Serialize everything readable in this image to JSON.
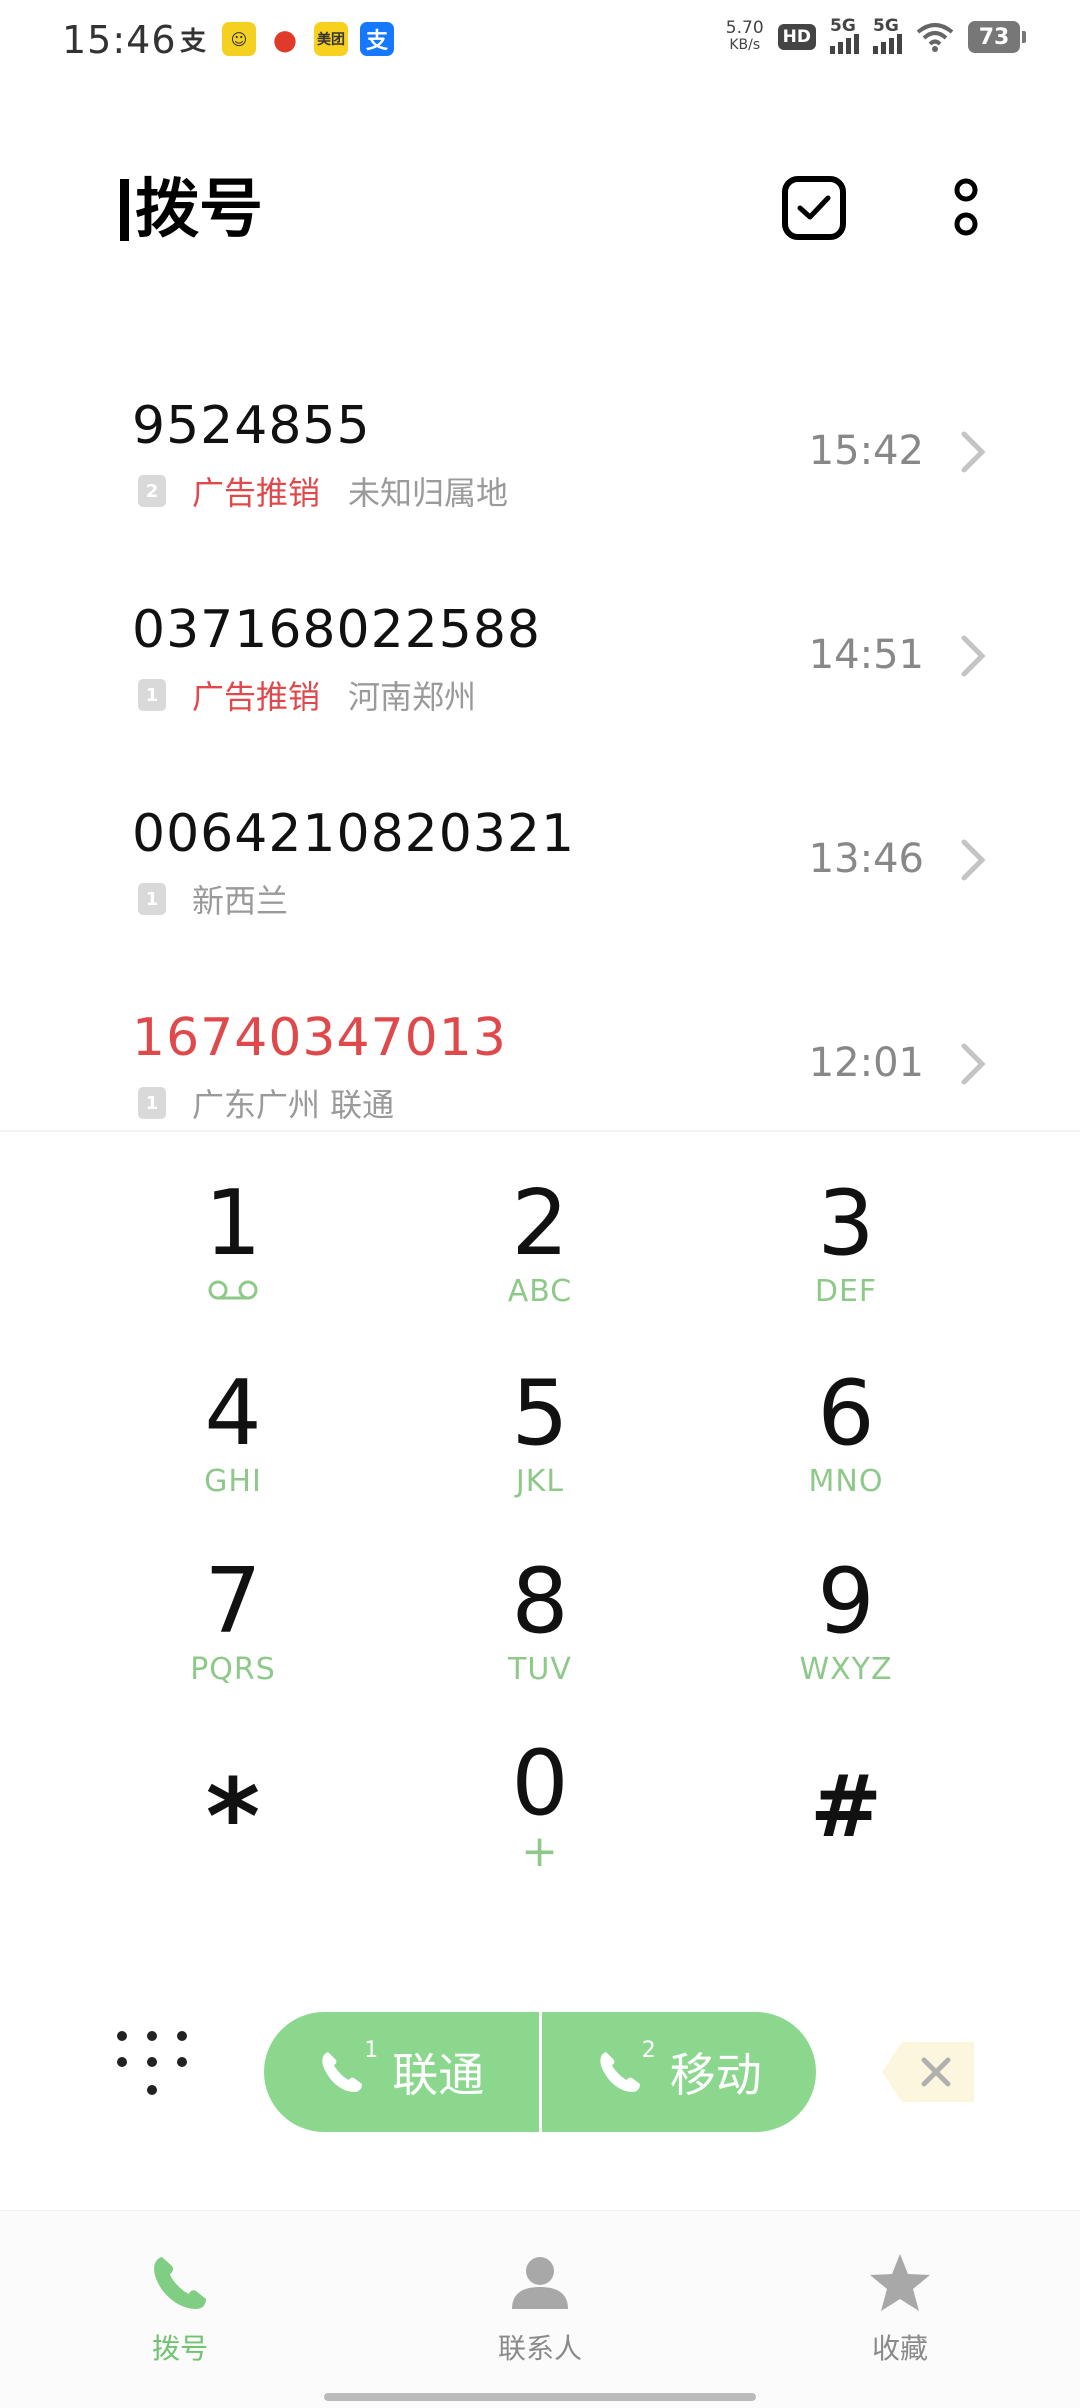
{
  "status": {
    "time": "15:46",
    "net_speed_value": "5.70",
    "net_speed_unit": "KB/s",
    "hd_label": "HD",
    "sim1_net": "5G",
    "sim2_net": "5G",
    "battery": "73",
    "notification_apps": [
      {
        "name": "alipay-icon",
        "glyph": "支"
      },
      {
        "name": "app-icon-yellow",
        "glyph": "🍋"
      },
      {
        "name": "app-icon-red",
        "glyph": "●"
      },
      {
        "name": "meituan-icon",
        "glyph": "美团"
      },
      {
        "name": "alipay-blue-icon",
        "glyph": "支"
      }
    ]
  },
  "header": {
    "title": "拨号"
  },
  "calls": [
    {
      "number": "9524855",
      "sim": "2",
      "tag": "广告推销",
      "location": "未知归属地",
      "time": "15:42",
      "missed": false
    },
    {
      "number": "037168022588",
      "sim": "1",
      "tag": "广告推销",
      "location": "河南郑州",
      "time": "14:51",
      "missed": false
    },
    {
      "number": "0064210820321",
      "sim": "1",
      "tag": "",
      "location": "新西兰",
      "time": "13:46",
      "missed": false
    },
    {
      "number": "16740347013",
      "sim": "1",
      "tag": "",
      "location": "广东广州 联通",
      "time": "12:01",
      "missed": true
    }
  ],
  "dialpad": {
    "keys": [
      {
        "digit": "1",
        "sub": ""
      },
      {
        "digit": "2",
        "sub": "ABC"
      },
      {
        "digit": "3",
        "sub": "DEF"
      },
      {
        "digit": "4",
        "sub": "GHI"
      },
      {
        "digit": "5",
        "sub": "JKL"
      },
      {
        "digit": "6",
        "sub": "MNO"
      },
      {
        "digit": "7",
        "sub": "PQRS"
      },
      {
        "digit": "8",
        "sub": "TUV"
      },
      {
        "digit": "9",
        "sub": "WXYZ"
      },
      {
        "digit": "*",
        "sub": ""
      },
      {
        "digit": "0",
        "sub": "+"
      },
      {
        "digit": "#",
        "sub": ""
      }
    ],
    "call_sim1_index": "1",
    "call_sim1_label": "联通",
    "call_sim2_index": "2",
    "call_sim2_label": "移动"
  },
  "nav": {
    "dial": "拨号",
    "contacts": "联系人",
    "favorites": "收藏"
  },
  "colors": {
    "accent_green": "#8cd78e",
    "spam_red": "#e0494b"
  }
}
